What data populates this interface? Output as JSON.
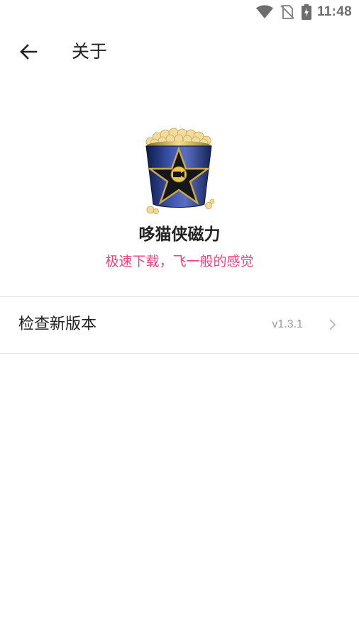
{
  "status_bar": {
    "time": "11:48",
    "icons": [
      "wifi-icon",
      "no-sim-icon",
      "battery-charging-icon"
    ]
  },
  "app_bar": {
    "back_icon": "arrow-left-icon",
    "title": "关于"
  },
  "about": {
    "app_logo": "popcorn-bucket-logo",
    "app_name": "哆猫侠磁力",
    "slogan": "极速下载，飞一般的感觉"
  },
  "settings": {
    "check_update": {
      "label": "检查新版本",
      "version": "v1.3.1",
      "chevron_icon": "chevron-right-icon"
    }
  },
  "colors": {
    "accent": "#f0417f",
    "text_primary": "#222222",
    "text_secondary": "#999999",
    "divider": "#e6e6e6"
  }
}
